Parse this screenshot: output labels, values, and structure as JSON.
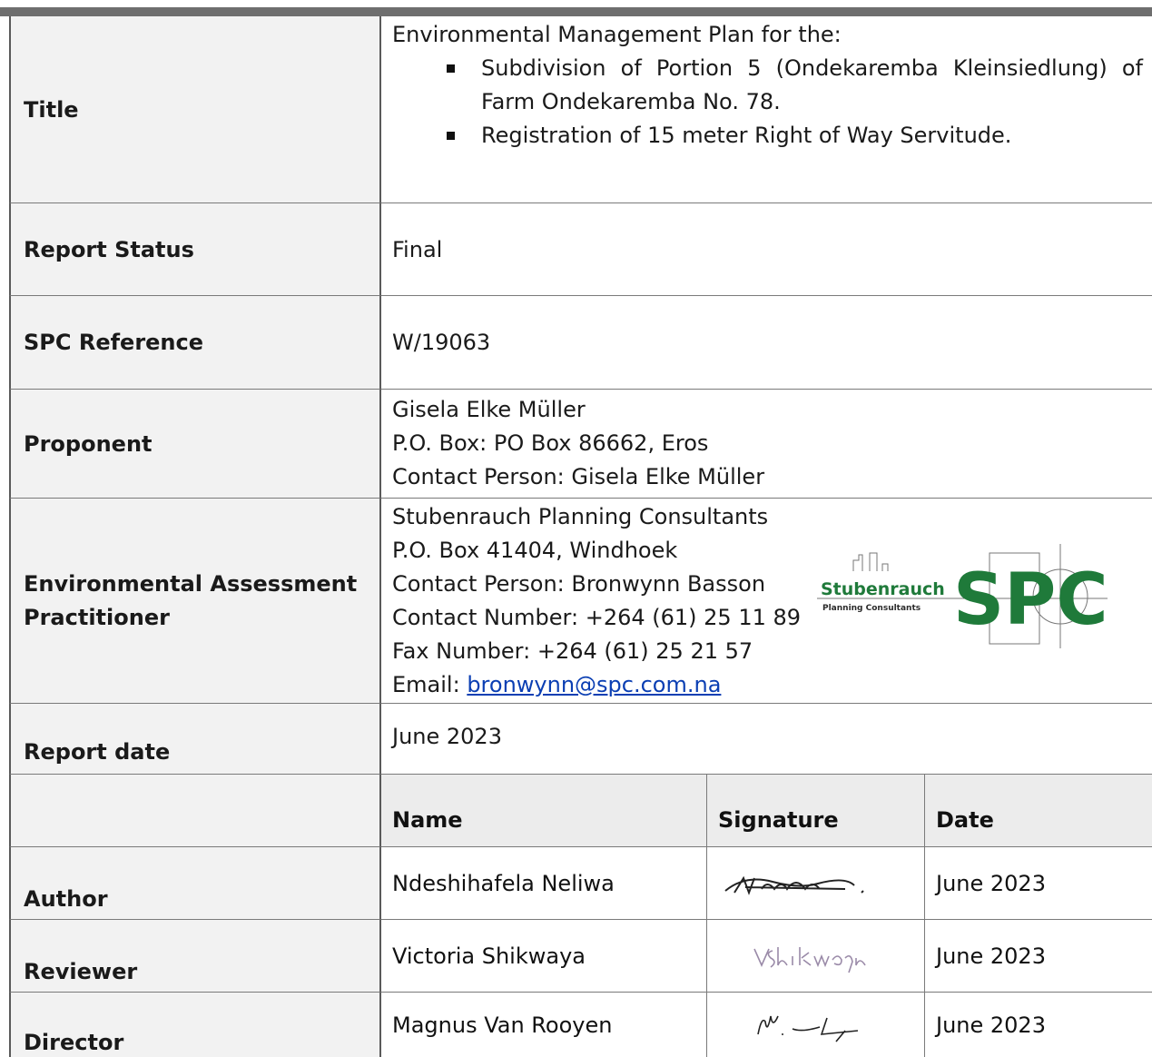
{
  "title_row": {
    "label": "Title",
    "intro": "Environmental Management Plan for the:",
    "bullets": [
      "Subdivision of Portion 5 (Ondekaremba Kleinsiedlung) of Farm Ondekaremba No. 78.",
      "Registration of 15 meter Right of Way Servitude."
    ]
  },
  "report_status": {
    "label": "Report Status",
    "value": "Final"
  },
  "spc_reference": {
    "label": "SPC Reference",
    "value": "W/19063"
  },
  "proponent": {
    "label": "Proponent",
    "lines": [
      "Gisela Elke Müller",
      "P.O. Box: PO Box 86662, Eros",
      "Contact Person: Gisela Elke Müller"
    ]
  },
  "eap": {
    "label": "Environmental Assessment Practitioner",
    "lines": [
      "Stubenrauch Planning Consultants",
      "P.O. Box 41404, Windhoek",
      "Contact Person: Bronwynn Basson",
      "Contact Number: +264 (61) 25 11 89",
      "Fax Number: +264 (61) 25 21 57"
    ],
    "email_prefix": "Email: ",
    "email": "bronwynn@spc.com.na",
    "logo": {
      "word": "Stubenrauch",
      "sub": "Planning Consultants",
      "mark": "SPC",
      "color": "#1f7a3a"
    }
  },
  "report_date": {
    "label": "Report date",
    "value": "June 2023"
  },
  "signoff": {
    "headers": [
      "Name",
      "Signature",
      "Date"
    ],
    "rows": [
      {
        "role": "Author",
        "name": "Ndeshihafela Neliwa",
        "date": "June 2023"
      },
      {
        "role": "Reviewer",
        "name": "Victoria Shikwaya",
        "date": "June 2023"
      },
      {
        "role": "Director",
        "name": "Magnus Van Rooyen",
        "date": "June 2023"
      }
    ]
  }
}
